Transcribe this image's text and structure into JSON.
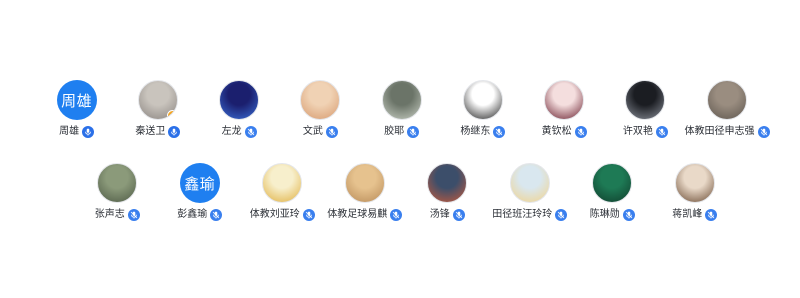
{
  "accent_color": "#1f7ff0",
  "participants": [
    {
      "name": "周雄",
      "avatar_text": "周雄",
      "avatar_kind": "initials",
      "mic": "on"
    },
    {
      "name": "秦送卫",
      "avatar_kind": "photo",
      "avatar_colors": [
        "#c9c4bd",
        "#8a8480"
      ],
      "host_badge": true,
      "mic": "on"
    },
    {
      "name": "左龙",
      "avatar_kind": "photo",
      "avatar_colors": [
        "#1b1f6e",
        "#3b6fd8"
      ],
      "mic": "muted"
    },
    {
      "name": "文武",
      "avatar_kind": "photo",
      "avatar_colors": [
        "#f0d2b4",
        "#d79a6e"
      ],
      "mic": "muted"
    },
    {
      "name": "胶耶",
      "avatar_kind": "photo",
      "avatar_colors": [
        "#6b7468",
        "#c9cfc4"
      ],
      "mic": "muted"
    },
    {
      "name": "杨继东",
      "avatar_kind": "photo",
      "avatar_colors": [
        "#ffffff",
        "#222222"
      ],
      "mic": "muted"
    },
    {
      "name": "黄钦松",
      "avatar_kind": "photo",
      "avatar_colors": [
        "#f4dede",
        "#6a2130"
      ],
      "mic": "muted"
    },
    {
      "name": "许双艳",
      "avatar_kind": "photo",
      "avatar_colors": [
        "#1b1d22",
        "#8a8f99"
      ],
      "mic": "muted"
    },
    {
      "name": "体教田径申志强",
      "avatar_kind": "photo",
      "avatar_colors": [
        "#9a8d80",
        "#5e564e"
      ],
      "mic": "muted"
    },
    {
      "name": "张声志",
      "avatar_kind": "photo",
      "avatar_colors": [
        "#8b9a7a",
        "#4e5a45"
      ],
      "mic": "muted"
    },
    {
      "name": "彭鑫瑜",
      "avatar_text": "鑫瑜",
      "avatar_kind": "initials",
      "mic": "muted"
    },
    {
      "name": "体教刘亚玲",
      "avatar_kind": "photo",
      "avatar_colors": [
        "#f7efcc",
        "#e0b040"
      ],
      "mic": "muted"
    },
    {
      "name": "体教足球易麒",
      "avatar_kind": "photo",
      "avatar_colors": [
        "#e6c28e",
        "#b88b58"
      ],
      "mic": "muted"
    },
    {
      "name": "汤锋",
      "avatar_kind": "photo",
      "avatar_colors": [
        "#3c4e6a",
        "#c75a3a"
      ],
      "mic": "muted"
    },
    {
      "name": "田径班汪玲玲",
      "avatar_kind": "photo",
      "avatar_colors": [
        "#d9e7ef",
        "#f2d38a"
      ],
      "mic": "muted"
    },
    {
      "name": "陈琳勋",
      "avatar_kind": "photo",
      "avatar_colors": [
        "#1e7a55",
        "#0f3d2b"
      ],
      "mic": "muted"
    },
    {
      "name": "蒋凯峰",
      "avatar_kind": "photo",
      "avatar_colors": [
        "#e9d9c8",
        "#6a4b34"
      ],
      "mic": "muted"
    }
  ]
}
